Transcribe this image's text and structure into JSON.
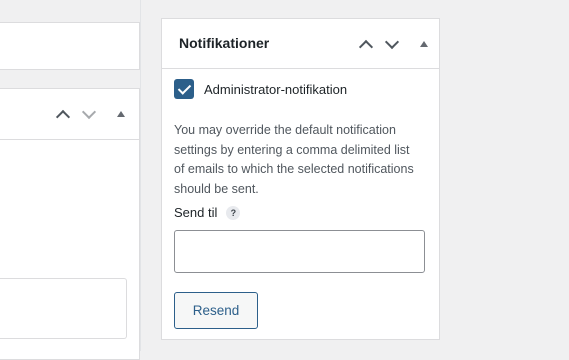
{
  "left_column": {
    "panel_controls": {
      "move_up_icon": "chevron-up-icon",
      "move_down_icon": "chevron-down-icon",
      "toggle_icon": "triangle-up-icon"
    }
  },
  "notifications_panel": {
    "title": "Notifikationer",
    "controls": {
      "move_up_icon": "chevron-up-icon",
      "move_down_icon": "chevron-down-icon",
      "toggle_icon": "triangle-up-icon"
    },
    "admin_checkbox": {
      "label": "Administrator-notifikation",
      "checked": true,
      "color": "#2c5f8a"
    },
    "description": "You may override the default notification settings by entering a comma delimited list of emails to which the selected notifications should be sent.",
    "send_to": {
      "label": "Send til",
      "help": "?",
      "value": "",
      "placeholder": ""
    },
    "resend_button": "Resend"
  },
  "colors": {
    "accent": "#2c5f8a",
    "background": "#f0f0f1",
    "border": "#dcdcde"
  }
}
